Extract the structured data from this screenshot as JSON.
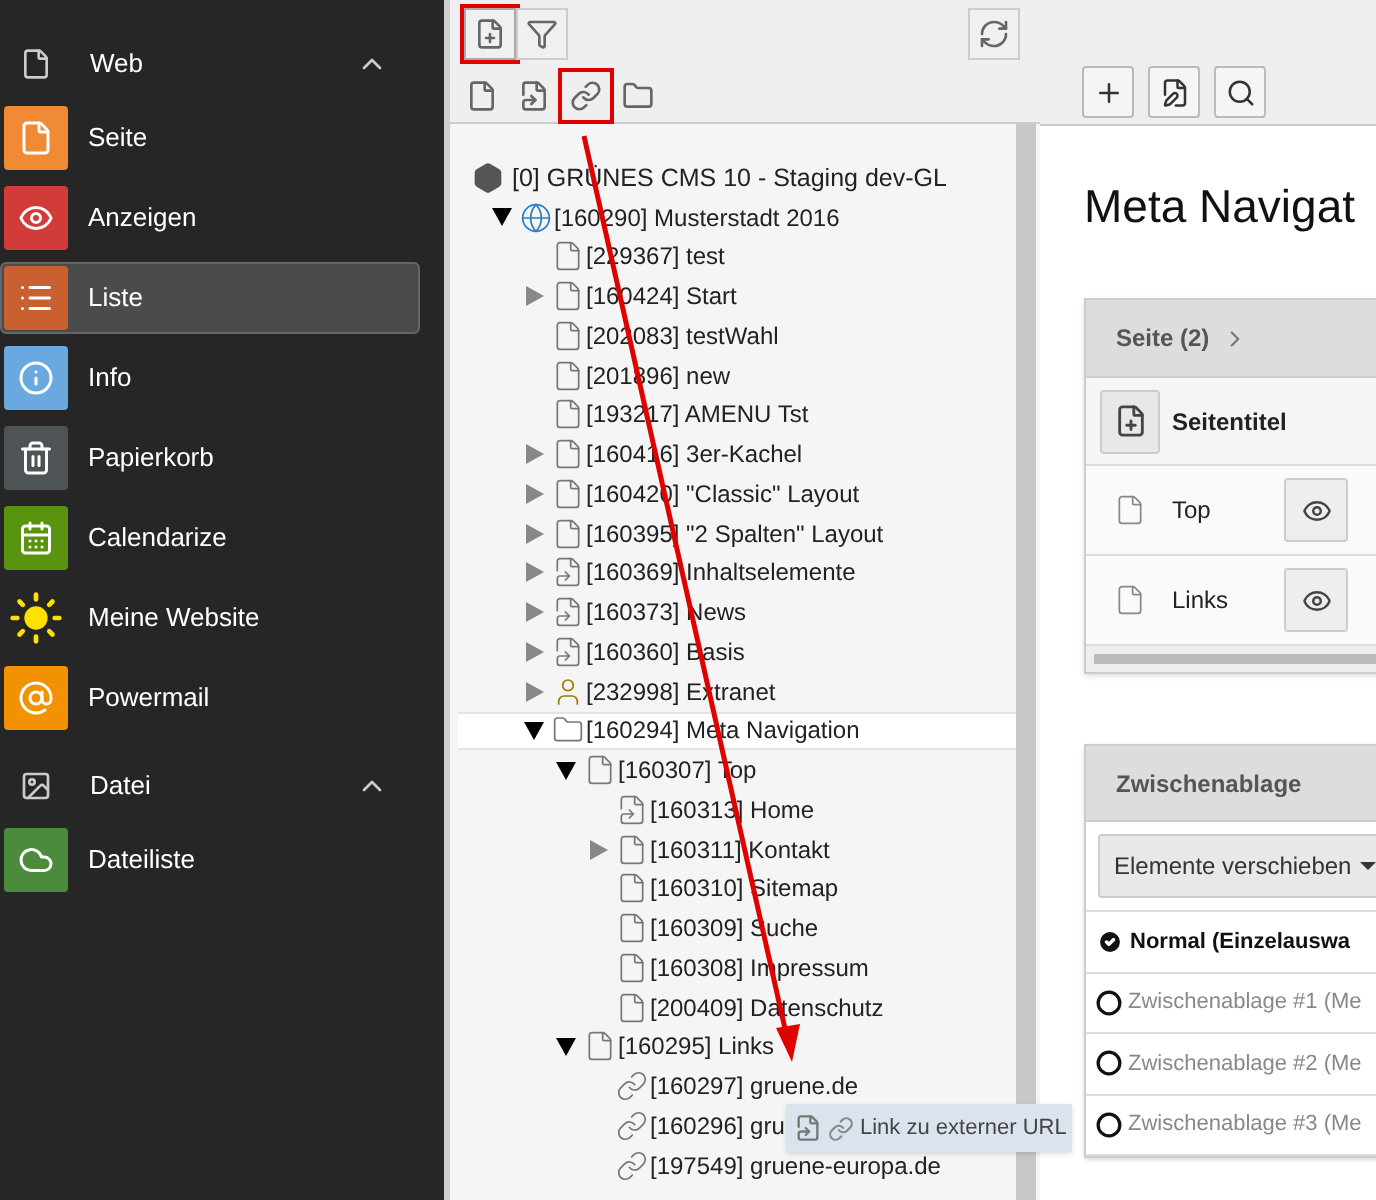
{
  "sidebar": {
    "groups": [
      {
        "label": "Web",
        "kind": "page",
        "expanded": true,
        "items": [
          {
            "label": "Seite",
            "color": "#f08a34",
            "selected": false
          },
          {
            "label": "Anzeigen",
            "color": "#d13b38",
            "selected": false
          },
          {
            "label": "Liste",
            "color": "#c8612f",
            "selected": true
          },
          {
            "label": "Info",
            "color": "#6aa8e0",
            "selected": false
          },
          {
            "label": "Papierkorb",
            "color": "#4e5356",
            "selected": false
          },
          {
            "label": "Calendarize",
            "color": "#5a9310",
            "selected": false
          },
          {
            "label": "Meine Website",
            "color": "#262626",
            "selected": false
          },
          {
            "label": "Powermail",
            "color": "#f39200",
            "selected": false
          }
        ]
      },
      {
        "label": "Datei",
        "kind": "image",
        "expanded": true,
        "items": [
          {
            "label": "Dateiliste",
            "color": "#4c8a3c",
            "selected": false
          }
        ]
      }
    ]
  },
  "tree_toolbar": {
    "buttons": [
      {
        "kind": "new-page",
        "highlighted": true
      },
      {
        "kind": "filter",
        "highlighted": false
      },
      {
        "kind": "refresh",
        "highlighted": false
      }
    ],
    "doktypes": [
      {
        "kind": "page",
        "highlighted": false
      },
      {
        "kind": "shortcut",
        "highlighted": false
      },
      {
        "kind": "link",
        "highlighted": true
      },
      {
        "kind": "folder",
        "highlighted": false
      }
    ]
  },
  "tree": {
    "root": {
      "label": "[0] GRÜNES CMS 10 - Staging dev-GL",
      "children": [
        {
          "label": "[160290] Musterstadt 2016",
          "kind": "site",
          "expanded": true,
          "selected": false,
          "children": [
            {
              "label": "[229367] test",
              "kind": "page",
              "selected": false
            },
            {
              "label": "[160424] Start",
              "kind": "page",
              "expanded": false,
              "selected": false
            },
            {
              "label": "[202083] testWahl",
              "kind": "page",
              "selected": false
            },
            {
              "label": "[201896] new",
              "kind": "page",
              "selected": false
            },
            {
              "label": "[193217] AMENU Tst",
              "kind": "page",
              "selected": false
            },
            {
              "label": "[160416] 3er-Kachel",
              "kind": "page",
              "expanded": false,
              "selected": false
            },
            {
              "label": "[160420] \"Classic\" Layout",
              "kind": "page",
              "expanded": false,
              "selected": false
            },
            {
              "label": "[160395] \"2 Spalten\" Layout",
              "kind": "page",
              "expanded": false,
              "selected": false
            },
            {
              "label": "[160369] Inhaltselemente",
              "kind": "shortcut",
              "expanded": false,
              "selected": false
            },
            {
              "label": "[160373] News",
              "kind": "shortcut",
              "expanded": false,
              "selected": false
            },
            {
              "label": "[160360] Basis",
              "kind": "shortcut",
              "expanded": false,
              "selected": false
            },
            {
              "label": "[232998] Extranet",
              "kind": "user",
              "expanded": false,
              "selected": false
            },
            {
              "label": "[160294] Meta Navigation",
              "kind": "folder",
              "expanded": true,
              "selected": true,
              "children": [
                {
                  "label": "[160307] Top",
                  "kind": "page",
                  "expanded": true,
                  "selected": false,
                  "children": [
                    {
                      "label": "[160313] Home",
                      "kind": "shortcut",
                      "selected": false
                    },
                    {
                      "label": "[160311] Kontakt",
                      "kind": "page",
                      "expanded": false,
                      "selected": false
                    },
                    {
                      "label": "[160310] Sitemap",
                      "kind": "page",
                      "selected": false
                    },
                    {
                      "label": "[160309] Suche",
                      "kind": "page",
                      "selected": false
                    },
                    {
                      "label": "[160308] Impressum",
                      "kind": "page",
                      "selected": false
                    },
                    {
                      "label": "[200409] Datenschutz",
                      "kind": "page",
                      "selected": false
                    }
                  ]
                },
                {
                  "label": "[160295] Links",
                  "kind": "page",
                  "expanded": true,
                  "selected": false,
                  "children": [
                    {
                      "label": "[160297] gruene.de",
                      "kind": "link",
                      "selected": false
                    },
                    {
                      "label": "[160296] gru",
                      "kind": "link",
                      "selected": false
                    },
                    {
                      "label": "[197549] gruene-europa.de",
                      "kind": "link",
                      "selected": false
                    }
                  ]
                }
              ]
            }
          ]
        }
      ]
    }
  },
  "drag_tooltip": {
    "label": "Link zu externer URL"
  },
  "content": {
    "title": "Meta Navigat",
    "pages_panel": {
      "title": "Seite (2)",
      "column": "Seitentitel",
      "rows": [
        "Top",
        "Links"
      ]
    },
    "clipboard": {
      "title": "Zwischenablage",
      "action": "Elemente verschieben",
      "options": [
        {
          "label": "Normal (Einzelauswa",
          "selected": true
        },
        {
          "label": "Zwischenablage #1 (Me",
          "selected": false
        },
        {
          "label": "Zwischenablage #2 (Me",
          "selected": false
        },
        {
          "label": "Zwischenablage #3 (Me",
          "selected": false
        }
      ]
    }
  }
}
